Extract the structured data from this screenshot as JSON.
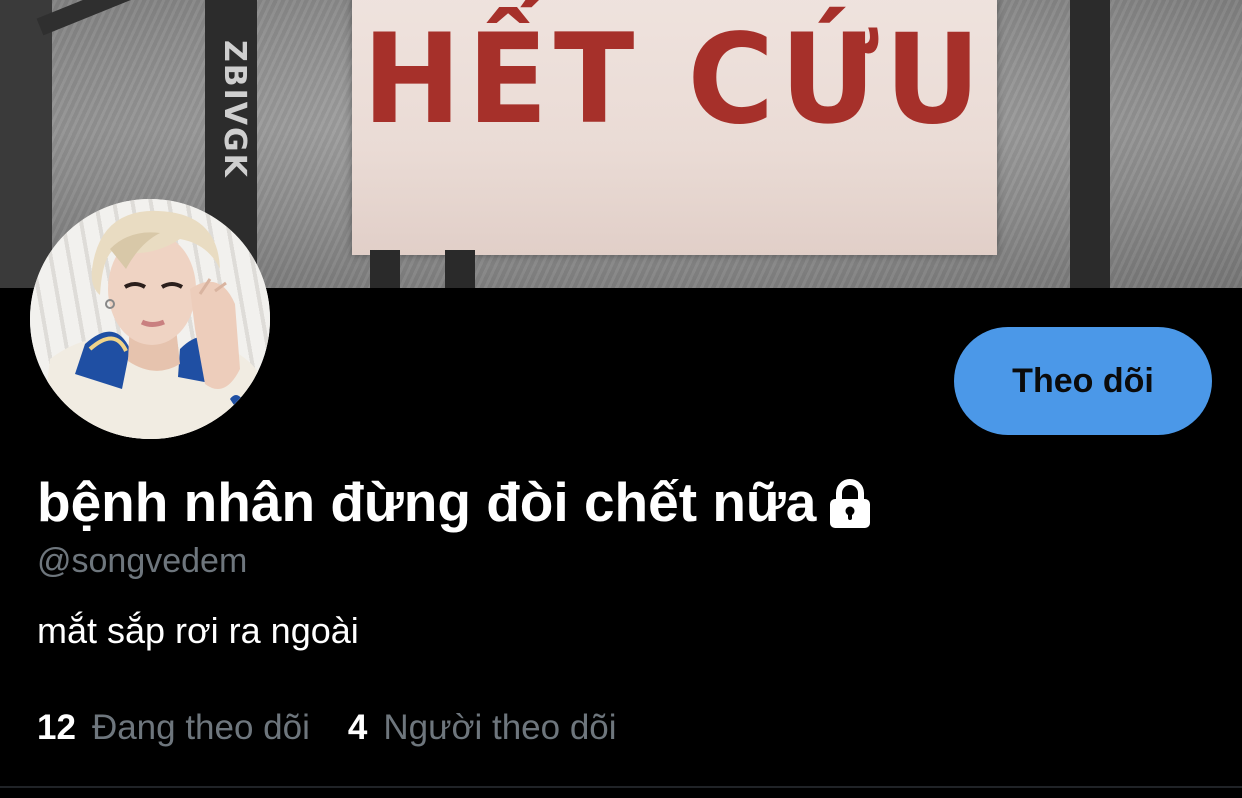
{
  "banner": {
    "sign_text": "HẾT CỨU",
    "bar_text": "ZBIVGK"
  },
  "profile": {
    "display_name": "bệnh nhân đừng đòi chết nữa",
    "handle": "@songvedem",
    "bio": "mắt sắp rơi ra ngoài",
    "protected": true
  },
  "follow_button": {
    "label": "Theo dõi"
  },
  "stats": {
    "following_count": "12",
    "following_label": "Đang theo dõi",
    "followers_count": "4",
    "followers_label": "Người theo dõi"
  },
  "colors": {
    "accent": "#4b98e8",
    "background": "#000000",
    "secondary_text": "#6e767d",
    "sign_text": "#a6302a"
  },
  "icons": {
    "lock": "lock-icon"
  }
}
